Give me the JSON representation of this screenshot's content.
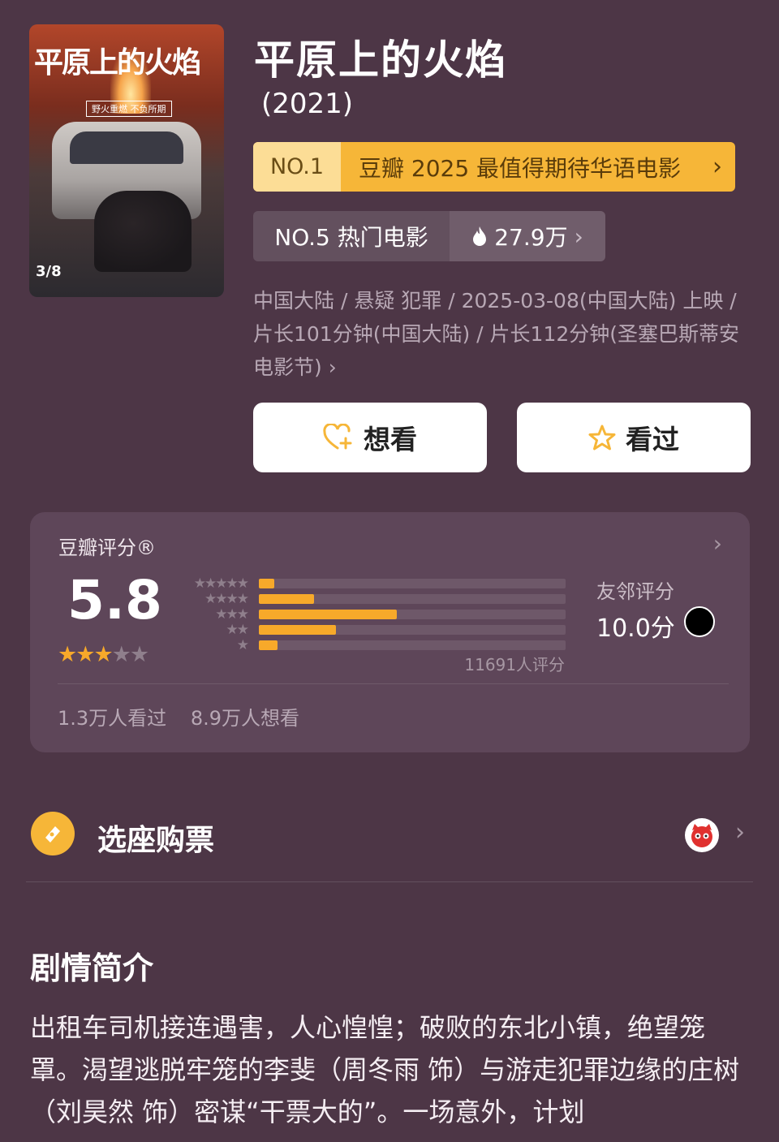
{
  "poster": {
    "title_art": "平原上的火焰",
    "tagline": "野火重燃 不负所期",
    "date_art": "3/8"
  },
  "movie": {
    "title": "平原上的火焰",
    "year": "(2021)"
  },
  "ranking_primary": {
    "badge": "NO.1",
    "text": "豆瓣 2025 最值得期待华语电影",
    "chevron": "›"
  },
  "ranking_secondary": {
    "rank_text": "NO.5 热门电影",
    "heat": "27.9万",
    "chevron": "›"
  },
  "meta": {
    "text": "中国大陆 / 悬疑 犯罪 / 2025-03-08(中国大陆) 上映 / 片长101分钟(中国大陆) / 片长112分钟(圣塞巴斯蒂安电影节)",
    "chevron": "›"
  },
  "actions": {
    "want_label": "想看",
    "seen_label": "看过"
  },
  "rating": {
    "label": "豆瓣评分®",
    "score": "5.8",
    "stars_filled": 3,
    "stars_total": 5,
    "distribution": [
      {
        "stars": "★★★★★",
        "fraction": 0.05
      },
      {
        "stars": "★★★★",
        "fraction": 0.18
      },
      {
        "stars": "★★★",
        "fraction": 0.45
      },
      {
        "stars": "★★",
        "fraction": 0.25
      },
      {
        "stars": "★",
        "fraction": 0.06
      }
    ],
    "count": "11691人评分",
    "friend_label": "友邻评分",
    "friend_score": "10.0分",
    "seen_count": "1.3万人看过",
    "want_count": "8.9万人想看"
  },
  "ticket": {
    "label": "选座购票"
  },
  "synopsis": {
    "title": "剧情简介",
    "text": "出租车司机接连遇害，人心惶惶；破败的东北小镇，绝望笼罩。渴望逃脱牢笼的李斐（周冬雨 饰）与游走犯罪边缘的庄树（刘昊然 饰）密谋“干票大的”。一场意外，计划"
  },
  "colors": {
    "background": "#4d3646",
    "accent": "#f6b638",
    "star": "#f7a92a"
  }
}
